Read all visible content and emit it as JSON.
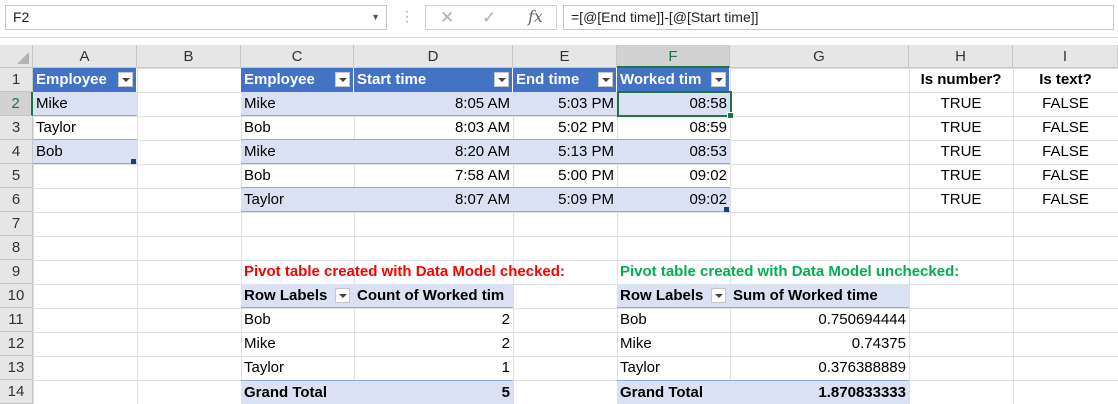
{
  "formula_bar": {
    "name_box": "F2",
    "formula": "=[@[End time]]-[@[Start time]]",
    "fx_label": "fx",
    "cancel_glyph": "✕",
    "enter_glyph": "✓"
  },
  "columns": [
    "A",
    "B",
    "C",
    "D",
    "E",
    "F",
    "G",
    "H",
    "I"
  ],
  "rows": [
    "1",
    "2",
    "3",
    "4",
    "5",
    "6",
    "7",
    "8",
    "9",
    "10",
    "11",
    "12",
    "13",
    "14"
  ],
  "table1": {
    "header": "Employee",
    "rows": [
      "Mike",
      "Taylor",
      "Bob"
    ]
  },
  "table2": {
    "headers": [
      "Employee",
      "Start time",
      "End time",
      "Worked tim"
    ],
    "rows": [
      [
        "Mike",
        "8:05 AM",
        "5:03 PM",
        "08:58"
      ],
      [
        "Bob",
        "8:03 AM",
        "5:02 PM",
        "08:59"
      ],
      [
        "Mike",
        "8:20 AM",
        "5:13 PM",
        "08:53"
      ],
      [
        "Bob",
        "7:58 AM",
        "5:00 PM",
        "09:02"
      ],
      [
        "Taylor",
        "8:07 AM",
        "5:09 PM",
        "09:02"
      ]
    ]
  },
  "checks": {
    "headers": [
      "Is number?",
      "Is text?"
    ],
    "rows": [
      [
        "TRUE",
        "FALSE"
      ],
      [
        "TRUE",
        "FALSE"
      ],
      [
        "TRUE",
        "FALSE"
      ],
      [
        "TRUE",
        "FALSE"
      ],
      [
        "TRUE",
        "FALSE"
      ]
    ]
  },
  "pivot1": {
    "caption": "Pivot table created with Data Model checked:",
    "headers": [
      "Row Labels",
      "Count of Worked tim"
    ],
    "rows": [
      [
        "Bob",
        "2"
      ],
      [
        "Mike",
        "2"
      ],
      [
        "Taylor",
        "1"
      ]
    ],
    "total": [
      "Grand Total",
      "5"
    ]
  },
  "pivot2": {
    "caption": "Pivot table created with Data Model unchecked:",
    "headers": [
      "Row Labels",
      "Sum of Worked time"
    ],
    "rows": [
      [
        "Bob",
        "0.750694444"
      ],
      [
        "Mike",
        "0.74375"
      ],
      [
        "Taylor",
        "0.376388889"
      ]
    ],
    "total": [
      "Grand Total",
      "1.870833333"
    ]
  },
  "colors": {
    "table_header": "#4472c4",
    "band": "#d9e1f2",
    "selection": "#217346",
    "red_caption": "#ff0000",
    "green_caption": "#00b050"
  }
}
